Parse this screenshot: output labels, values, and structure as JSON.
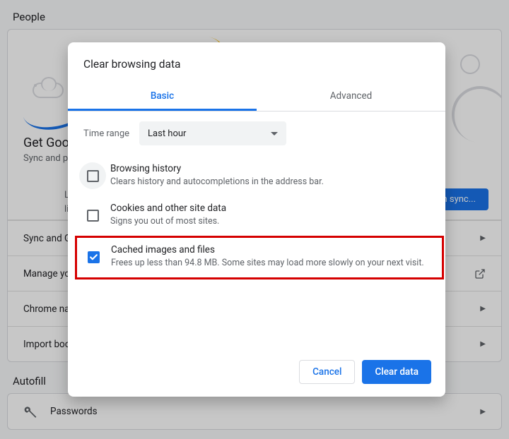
{
  "bg": {
    "section_people": "People",
    "hero_title": "Get Goo",
    "hero_sub": "Sync and p",
    "signin_line1": "L",
    "signin_line2": "li",
    "sync_button": "n sync...",
    "rows": [
      {
        "label": "Sync and G"
      },
      {
        "label": "Manage yo"
      },
      {
        "label": "Chrome na"
      },
      {
        "label": "Import boo"
      }
    ],
    "section_autofill": "Autofill",
    "passwords": "Passwords"
  },
  "dialog": {
    "title": "Clear browsing data",
    "tab_basic": "Basic",
    "tab_advanced": "Advanced",
    "time_range_label": "Time range",
    "time_range_value": "Last hour",
    "items": [
      {
        "title": "Browsing history",
        "desc": "Clears history and autocompletions in the address bar."
      },
      {
        "title": "Cookies and other site data",
        "desc": "Signs you out of most sites."
      },
      {
        "title": "Cached images and files",
        "desc": "Frees up less than 94.8 MB. Some sites may load more slowly on your next visit."
      }
    ],
    "cancel": "Cancel",
    "confirm": "Clear data"
  }
}
